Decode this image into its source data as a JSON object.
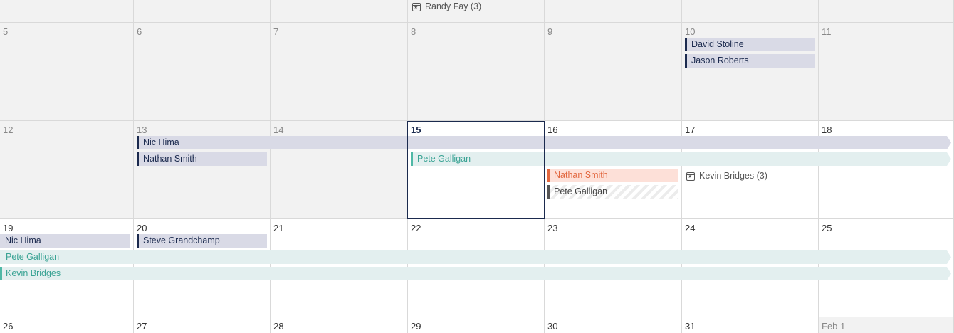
{
  "weeks": [
    {
      "days": [
        "",
        "",
        "",
        "",
        "",
        "",
        ""
      ]
    },
    {
      "days": [
        "5",
        "6",
        "7",
        "8",
        "9",
        "10",
        "11"
      ]
    },
    {
      "days": [
        "12",
        "13",
        "14",
        "15",
        "16",
        "17",
        "18"
      ]
    },
    {
      "days": [
        "19",
        "20",
        "21",
        "22",
        "23",
        "24",
        "25"
      ]
    },
    {
      "days": [
        "26",
        "27",
        "28",
        "29",
        "30",
        "31",
        "Feb 1"
      ]
    }
  ],
  "groups": {
    "randy": "Randy Fay (3)",
    "kevin": "Kevin Bridges (3)"
  },
  "events": {
    "w1_david": "David Stoline",
    "w1_jason": "Jason Roberts",
    "w2_nic": "Nic Hima",
    "w2_nathan": "Nathan Smith",
    "w2_pete_teal": "Pete Galligan",
    "w2_nathan_orange": "Nathan Smith",
    "w2_pete_hatch": "Pete Galligan",
    "w3_nic": "Nic Hima",
    "w3_steve": "Steve Grandchamp",
    "w3_pete": "Pete Galligan",
    "w3_kevin": "Kevin Bridges"
  },
  "colors": {
    "navy": "#1b2a4e",
    "teal": "#4fb8a6",
    "orange": "#e2673f",
    "past_bg": "#f2f2f2"
  }
}
